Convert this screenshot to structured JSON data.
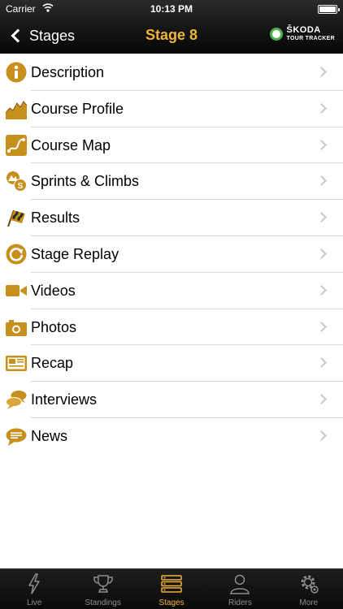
{
  "status_bar": {
    "carrier": "Carrier",
    "time": "10:13 PM",
    "icons": [
      "wifi-icon",
      "battery-icon"
    ]
  },
  "nav_bar": {
    "back_label": "Stages",
    "title": "Stage 8",
    "brand_name": "ŠKODA",
    "brand_tagline": "TOUR TRACKER"
  },
  "colors": {
    "accent_gold": "#f0b43a",
    "icon_gold": "#c7901c",
    "bar_dark": "#151515",
    "separator": "#d9d9d9",
    "disclosure": "#c7c7cc"
  },
  "menu": {
    "items": [
      {
        "label": "Description",
        "icon": "info-icon"
      },
      {
        "label": "Course Profile",
        "icon": "course-profile-icon"
      },
      {
        "label": "Course Map",
        "icon": "course-map-icon"
      },
      {
        "label": "Sprints & Climbs",
        "icon": "sprints-climbs-icon"
      },
      {
        "label": "Results",
        "icon": "checkered-flag-icon"
      },
      {
        "label": "Stage Replay",
        "icon": "replay-icon"
      },
      {
        "label": "Videos",
        "icon": "video-camera-icon"
      },
      {
        "label": "Photos",
        "icon": "photo-camera-icon"
      },
      {
        "label": "Recap",
        "icon": "newspaper-icon"
      },
      {
        "label": "Interviews",
        "icon": "chat-bubbles-icon"
      },
      {
        "label": "News",
        "icon": "speech-bubble-icon"
      }
    ]
  },
  "tab_bar": {
    "active": "Stages",
    "tabs": [
      {
        "label": "Live",
        "icon": "lightning-icon"
      },
      {
        "label": "Standings",
        "icon": "trophy-icon"
      },
      {
        "label": "Stages",
        "icon": "list-icon"
      },
      {
        "label": "Riders",
        "icon": "person-icon"
      },
      {
        "label": "More",
        "icon": "gear-icon"
      }
    ]
  }
}
